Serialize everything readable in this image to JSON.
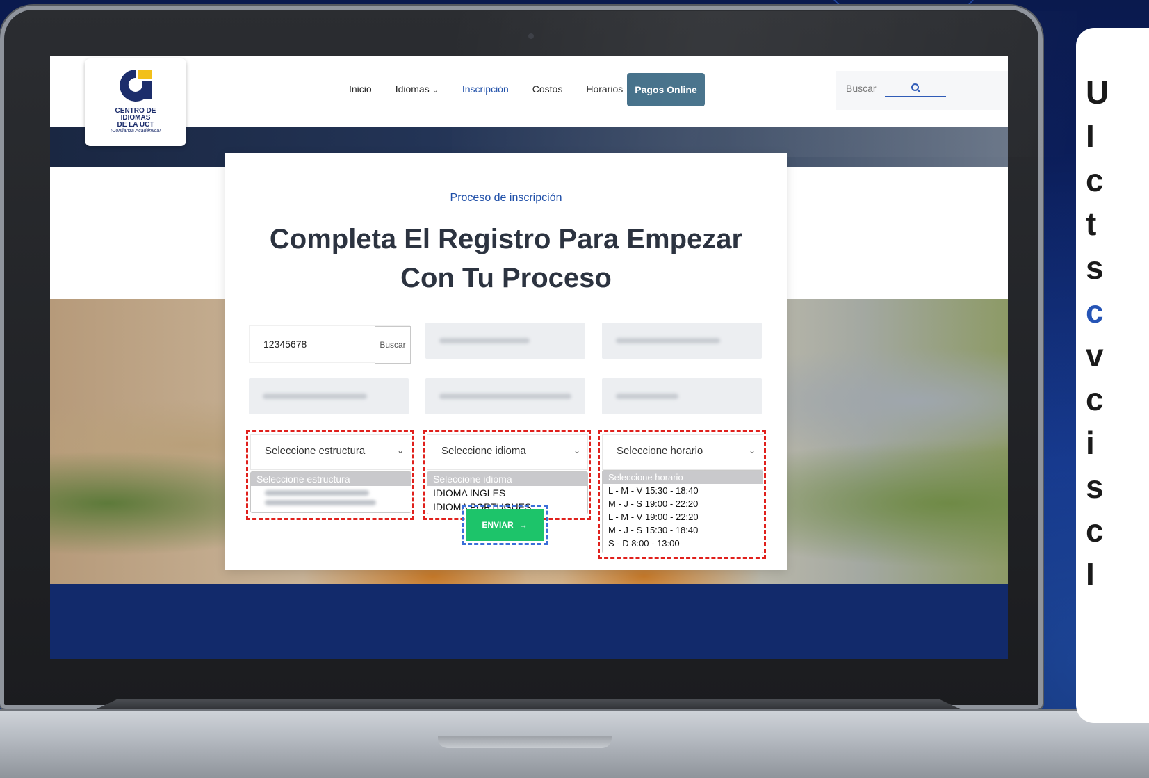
{
  "header": {
    "logo_lines": [
      "CENTRO DE",
      "IDIOMAS",
      "DE LA UCT"
    ],
    "logo_tagline": "¡Confianza Académica!",
    "nav": [
      {
        "label": "Inicio"
      },
      {
        "label": "Idiomas"
      },
      {
        "label": "Inscripción"
      },
      {
        "label": "Costos"
      },
      {
        "label": "Horarios"
      }
    ],
    "pagos_label": "Pagos Online",
    "search_placeholder": "Buscar"
  },
  "form": {
    "subtitle": "Proceso de inscripción",
    "title": "Completa El Registro Para Empezar Con Tu Proceso",
    "dni_value": "12345678",
    "dni_button": "Buscar",
    "select_estructura": {
      "label": "Seleccione estructura",
      "options_selected": "Seleccione estructura"
    },
    "select_idioma": {
      "label": "Seleccione idioma",
      "options": [
        "Seleccione idioma",
        "IDIOMA INGLES",
        "IDIOMA PORTUGUES"
      ]
    },
    "select_horario": {
      "label": "Seleccione horario",
      "options": [
        "Seleccione horario",
        "L - M - V 15:30 - 18:40",
        "M - J - S 19:00 - 22:20",
        "L - M - V 19:00 - 22:20",
        "M - J - S 15:30 - 18:40",
        "S - D 8:00 - 13:00"
      ]
    },
    "submit_label": "ENVIAR",
    "submit_arrow": "→"
  },
  "side_text": {
    "letters": [
      "U",
      "I",
      "c",
      "t",
      "s",
      "c",
      "v",
      "c",
      "i",
      "s",
      "c",
      "I"
    ]
  },
  "colors": {
    "accent_blue": "#1f4fa8",
    "pagos_button": "#3f6c86",
    "submit_green": "#1dc46a",
    "highlight_red": "#e0201c",
    "highlight_blue": "#3a6fd8",
    "footer_navy": "#122a6b"
  }
}
